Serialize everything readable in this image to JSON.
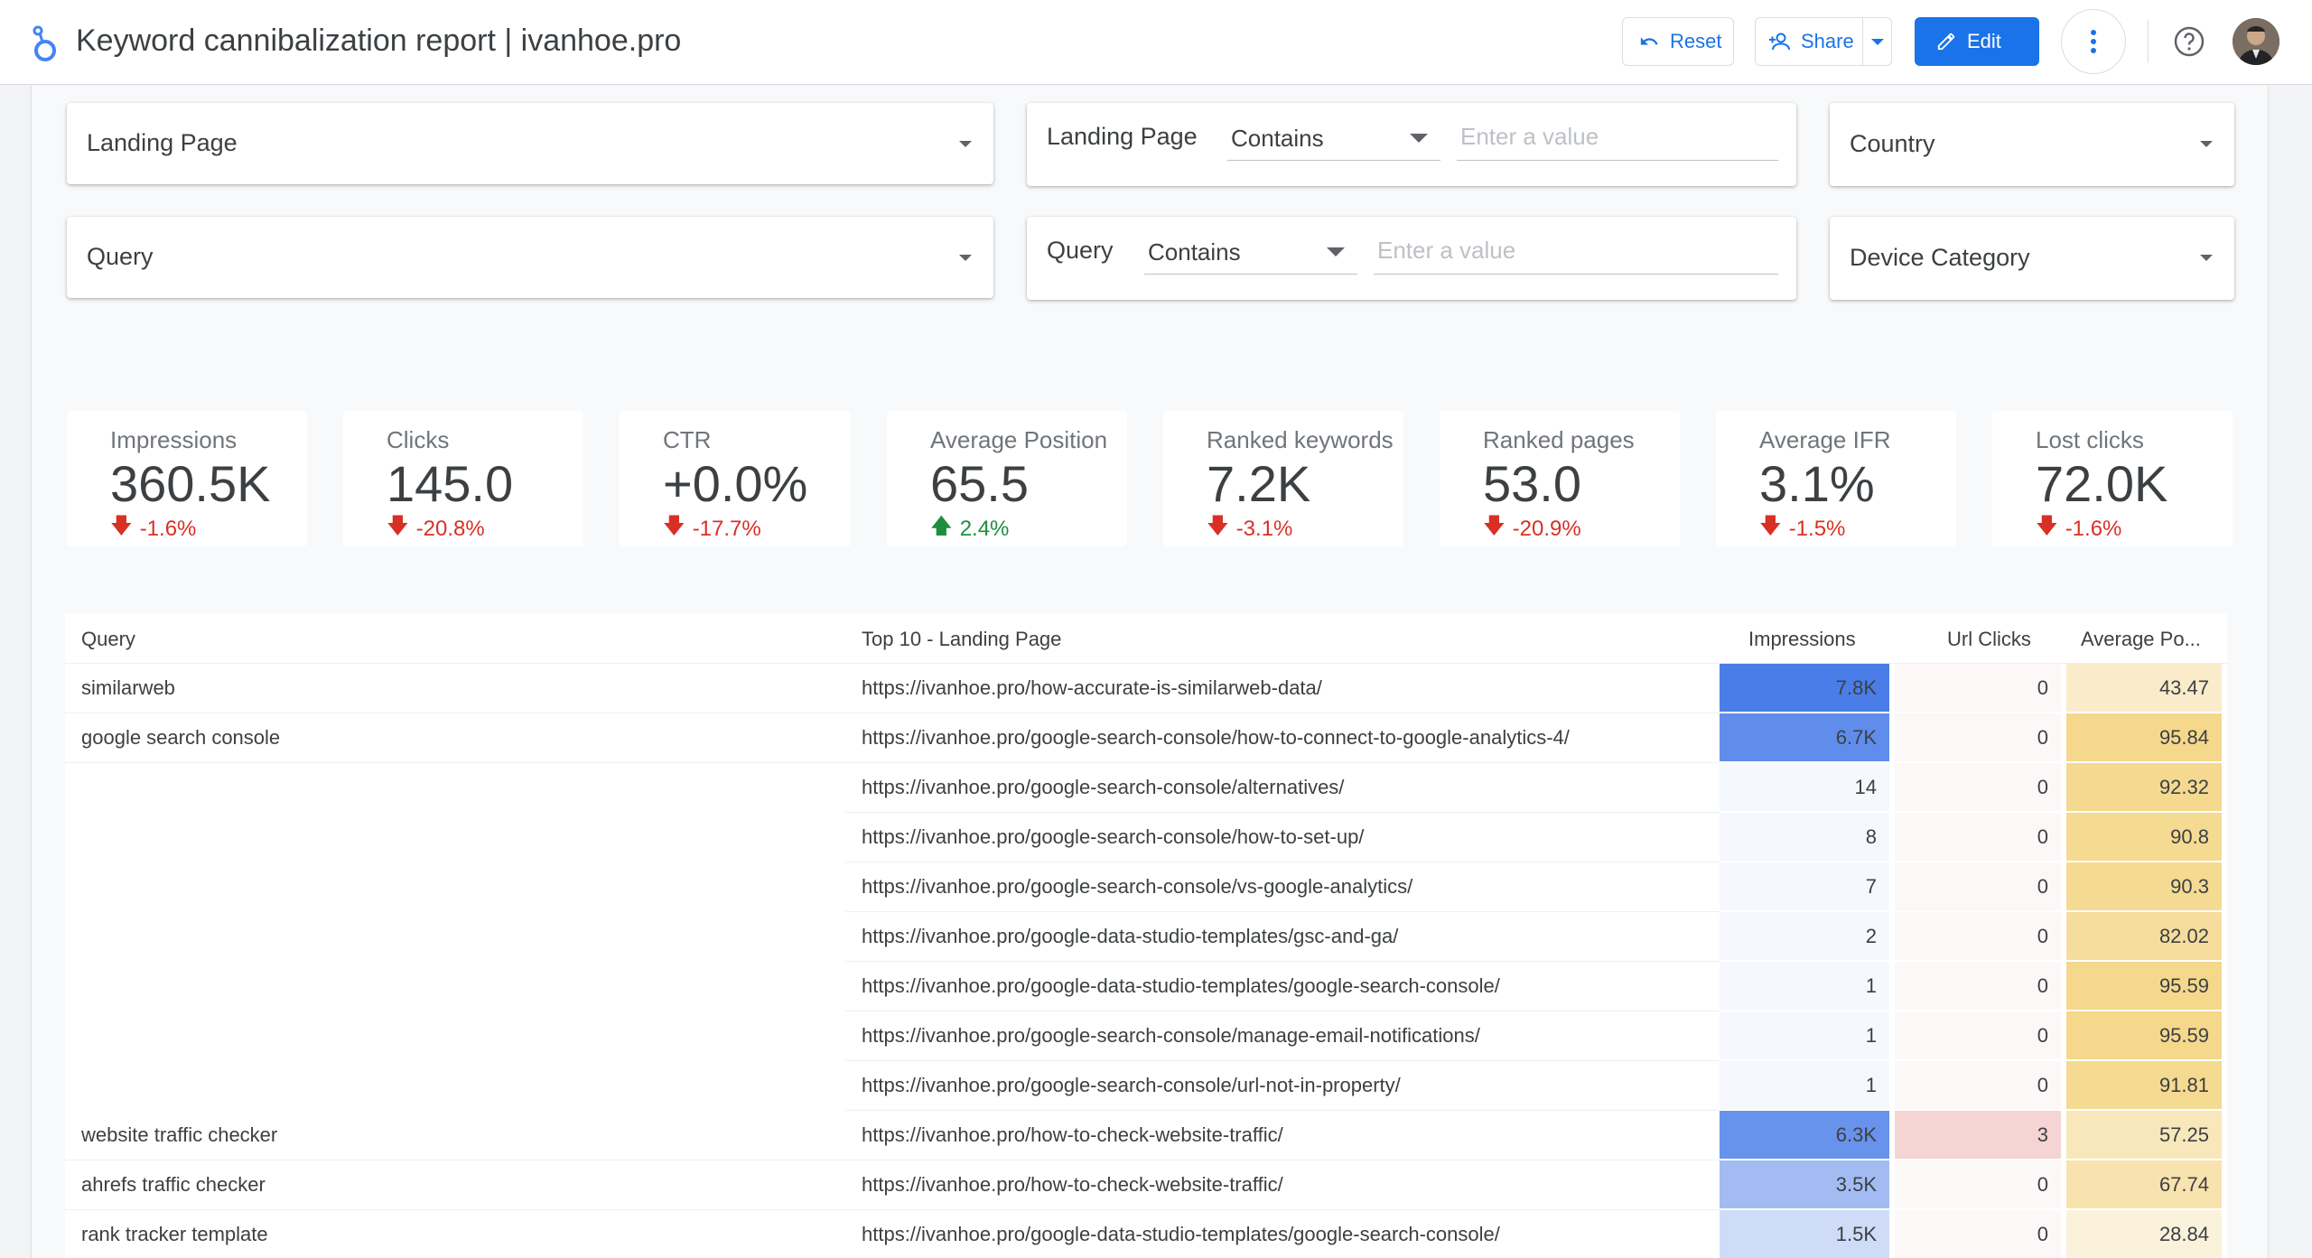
{
  "header": {
    "title": "Keyword cannibalization report | ivanhoe.pro",
    "reset_label": "Reset",
    "share_label": "Share",
    "edit_label": "Edit",
    "accent_color": "#1a73e8"
  },
  "filters": {
    "landing_page_dropdown": "Landing Page",
    "query_dropdown": "Query",
    "country_dropdown": "Country",
    "device_dropdown": "Device Category",
    "landing_page_filter": {
      "label": "Landing Page",
      "operator": "Contains",
      "placeholder": "Enter a value"
    },
    "query_filter": {
      "label": "Query",
      "operator": "Contains",
      "placeholder": "Enter a value"
    }
  },
  "scorecards": [
    {
      "label": "Impressions",
      "value": "360.5K",
      "delta": "-1.6%",
      "direction": "down"
    },
    {
      "label": "Clicks",
      "value": "145.0",
      "delta": "-20.8%",
      "direction": "down"
    },
    {
      "label": "CTR",
      "value": "+0.0%",
      "delta": "-17.7%",
      "direction": "down"
    },
    {
      "label": "Average Position",
      "value": "65.5",
      "delta": "2.4%",
      "direction": "up"
    },
    {
      "label": "Ranked keywords",
      "value": "7.2K",
      "delta": "-3.1%",
      "direction": "down"
    },
    {
      "label": "Ranked pages",
      "value": "53.0",
      "delta": "-20.9%",
      "direction": "down"
    },
    {
      "label": "Average IFR",
      "value": "3.1%",
      "delta": "-1.5%",
      "direction": "down"
    },
    {
      "label": "Lost clicks",
      "value": "72.0K",
      "delta": "-1.6%",
      "direction": "down"
    }
  ],
  "table": {
    "headers": {
      "query": "Query",
      "landing": "Top 10 - Landing Page",
      "impressions": "Impressions",
      "clicks": "Url Clicks",
      "position": "Average Po..."
    },
    "rows": [
      {
        "query": "similarweb",
        "landing": "https://ivanhoe.pro/how-accurate-is-similarweb-data/",
        "impressions": "7.8K",
        "imp_value": 7800,
        "clicks": "0",
        "clicks_value": 0,
        "position": "43.47",
        "pos_value": 43.47
      },
      {
        "query": "google search console",
        "landing": "https://ivanhoe.pro/google-search-console/how-to-connect-to-google-analytics-4/",
        "impressions": "6.7K",
        "imp_value": 6700,
        "clicks": "0",
        "clicks_value": 0,
        "position": "95.84",
        "pos_value": 95.84
      },
      {
        "query": "",
        "landing": "https://ivanhoe.pro/google-search-console/alternatives/",
        "impressions": "14",
        "imp_value": 14,
        "clicks": "0",
        "clicks_value": 0,
        "position": "92.32",
        "pos_value": 92.32
      },
      {
        "query": "",
        "landing": "https://ivanhoe.pro/google-search-console/how-to-set-up/",
        "impressions": "8",
        "imp_value": 8,
        "clicks": "0",
        "clicks_value": 0,
        "position": "90.8",
        "pos_value": 90.8
      },
      {
        "query": "",
        "landing": "https://ivanhoe.pro/google-search-console/vs-google-analytics/",
        "impressions": "7",
        "imp_value": 7,
        "clicks": "0",
        "clicks_value": 0,
        "position": "90.3",
        "pos_value": 90.3
      },
      {
        "query": "",
        "landing": "https://ivanhoe.pro/google-data-studio-templates/gsc-and-ga/",
        "impressions": "2",
        "imp_value": 2,
        "clicks": "0",
        "clicks_value": 0,
        "position": "82.02",
        "pos_value": 82.02
      },
      {
        "query": "",
        "landing": "https://ivanhoe.pro/google-data-studio-templates/google-search-console/",
        "impressions": "1",
        "imp_value": 1,
        "clicks": "0",
        "clicks_value": 0,
        "position": "95.59",
        "pos_value": 95.59
      },
      {
        "query": "",
        "landing": "https://ivanhoe.pro/google-search-console/manage-email-notifications/",
        "impressions": "1",
        "imp_value": 1,
        "clicks": "0",
        "clicks_value": 0,
        "position": "95.59",
        "pos_value": 95.59
      },
      {
        "query": "",
        "landing": "https://ivanhoe.pro/google-search-console/url-not-in-property/",
        "impressions": "1",
        "imp_value": 1,
        "clicks": "0",
        "clicks_value": 0,
        "position": "91.81",
        "pos_value": 91.81
      },
      {
        "query": "website traffic checker",
        "landing": "https://ivanhoe.pro/how-to-check-website-traffic/",
        "impressions": "6.3K",
        "imp_value": 6300,
        "clicks": "3",
        "clicks_value": 3,
        "position": "57.25",
        "pos_value": 57.25
      },
      {
        "query": "ahrefs traffic checker",
        "landing": "https://ivanhoe.pro/how-to-check-website-traffic/",
        "impressions": "3.5K",
        "imp_value": 3500,
        "clicks": "0",
        "clicks_value": 0,
        "position": "67.74",
        "pos_value": 67.74
      },
      {
        "query": "rank tracker template",
        "landing": "https://ivanhoe.pro/google-data-studio-templates/google-search-console/",
        "impressions": "1.5K",
        "imp_value": 1500,
        "clicks": "0",
        "clicks_value": 0,
        "position": "28.84",
        "pos_value": 28.84
      }
    ],
    "colors": {
      "impressions_max": "#4a7de8",
      "impressions_min": "#f6f8fd",
      "clicks_max": "#f5d4d4",
      "clicks_min": "#fcf8f8",
      "position_max": "#f5d88c",
      "position_min": "#fbf2dc"
    }
  }
}
